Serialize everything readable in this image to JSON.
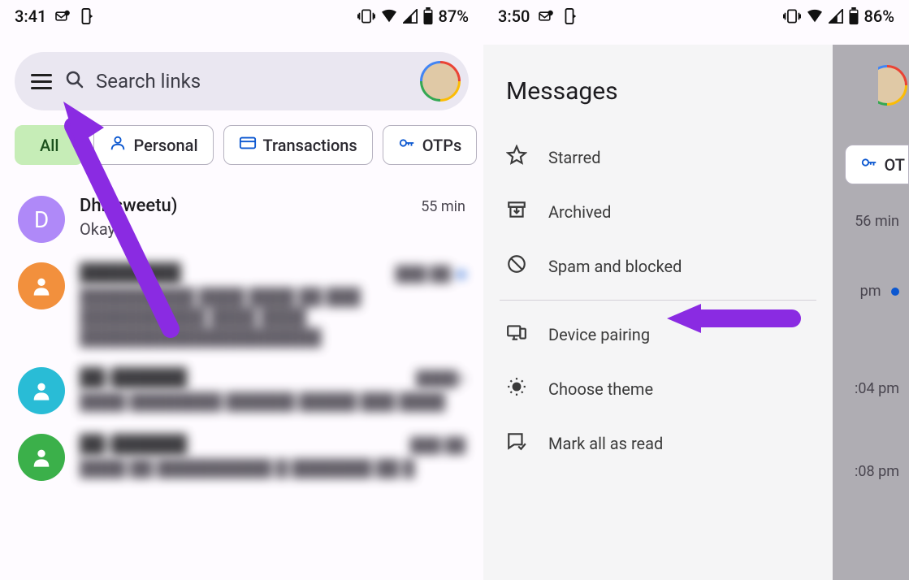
{
  "left": {
    "status": {
      "time": "3:41",
      "battery": "87%"
    },
    "search": {
      "placeholder": "Search links"
    },
    "chips": {
      "all": "All",
      "personal": "Personal",
      "transactions": "Transactions",
      "otps": "OTPs"
    },
    "conversations": [
      {
        "avatar_letter": "D",
        "name": "Dhr(sweetu)",
        "preview": "Okay",
        "time": "55 min"
      },
      {
        "avatar_letter": "",
        "name": "████████",
        "preview": "██████████ ████ ████ ██ ███\n███████████ ████ ████\n█████████████████████",
        "time": "███ ██"
      },
      {
        "avatar_letter": "",
        "name": "██-██████",
        "preview": "████ ████████ ██████ █████ ███ ████",
        "time": "████n"
      },
      {
        "avatar_letter": "",
        "name": "██-██████",
        "preview": "████ ██ ██████████ █ ███████ ██ █",
        "time": "███ ██"
      }
    ]
  },
  "right": {
    "status": {
      "time": "3:50",
      "battery": "86%"
    },
    "drawer": {
      "title": "Messages",
      "items": {
        "starred": "Starred",
        "archived": "Archived",
        "spam": "Spam and blocked",
        "pairing": "Device pairing",
        "theme": "Choose theme",
        "markread": "Mark all as read"
      }
    },
    "under": {
      "chip_ot": "OT",
      "t1": "56 min",
      "t2": "pm",
      "t3": ":04 pm",
      "t4": ":08 pm"
    }
  }
}
